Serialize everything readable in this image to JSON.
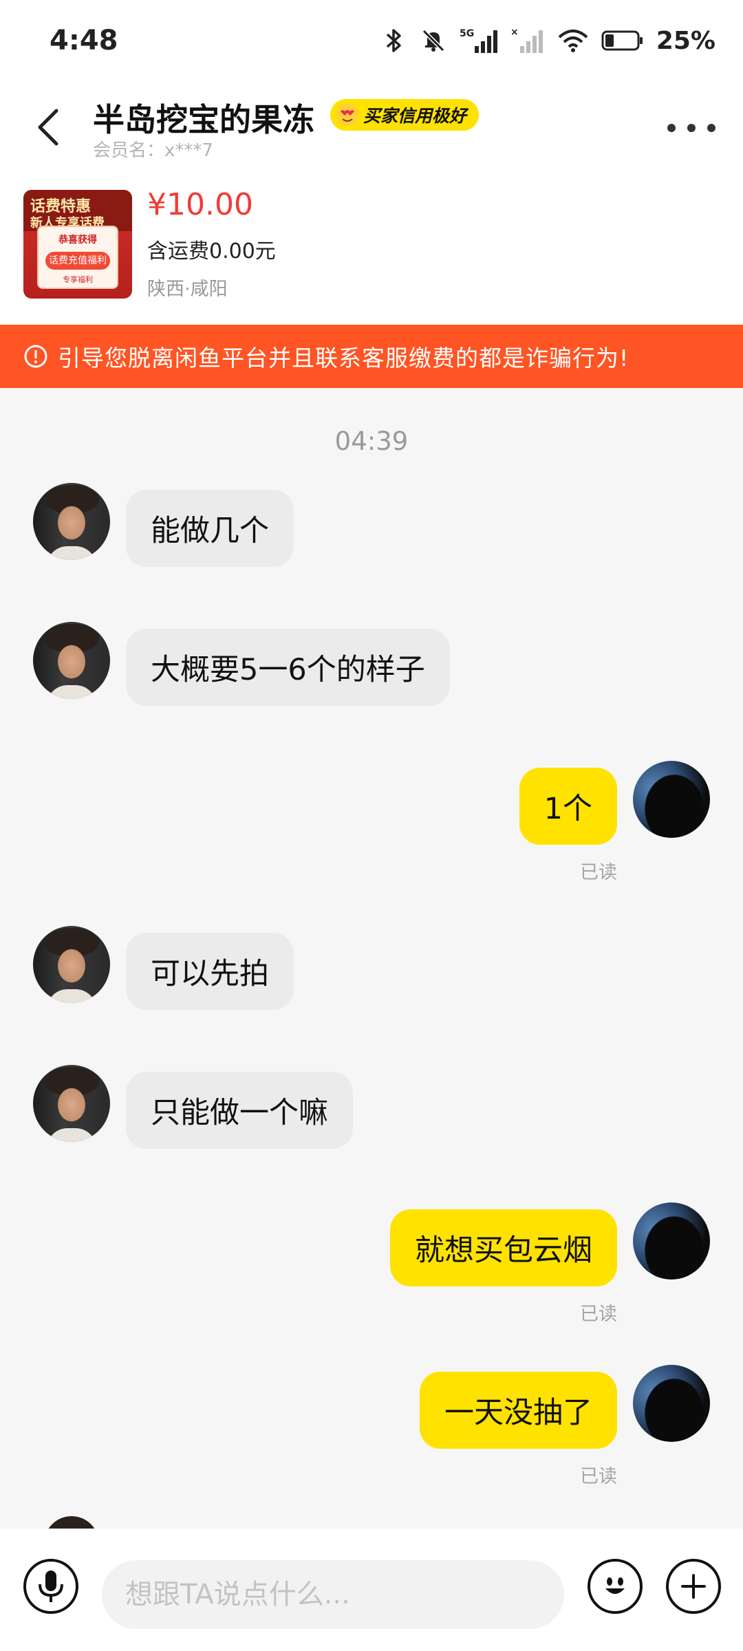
{
  "status_bar": {
    "time": "4:48",
    "network": "5G",
    "battery_percent": "25%"
  },
  "header": {
    "title": "半岛挖宝的果冻",
    "credit_badge": "买家信用极好",
    "member_name": "会员名：x***7"
  },
  "product": {
    "price": "¥10.00",
    "shipping": "含运费0.00元",
    "location": "陕西·咸阳",
    "thumb_title": "话费特惠",
    "thumb_subtitle": "新人专享话费",
    "thumb_card_top": "恭喜获得",
    "thumb_card_button": "话费充值福利",
    "thumb_card_bottom": "专享福利"
  },
  "warning": {
    "text": "引导您脱离闲鱼平台并且联系客服缴费的都是诈骗行为!"
  },
  "chat": {
    "timestamp": "04:39",
    "messages": [
      {
        "from": "other",
        "text": "能做几个"
      },
      {
        "from": "other",
        "text": "大概要5一6个的样子"
      },
      {
        "from": "self",
        "text": "1个",
        "status": "已读"
      },
      {
        "from": "other",
        "text": "可以先拍"
      },
      {
        "from": "other",
        "text": "只能做一个嘛"
      },
      {
        "from": "self",
        "text": "就想买包云烟",
        "status": "已读"
      },
      {
        "from": "self",
        "text": "一天没抽了",
        "status": "已读"
      }
    ]
  },
  "input": {
    "placeholder": "想跟TA说点什么..."
  },
  "colors": {
    "accent_yellow": "#ffe200",
    "warning_orange": "#ff5423",
    "price_red": "#ef3b35"
  }
}
